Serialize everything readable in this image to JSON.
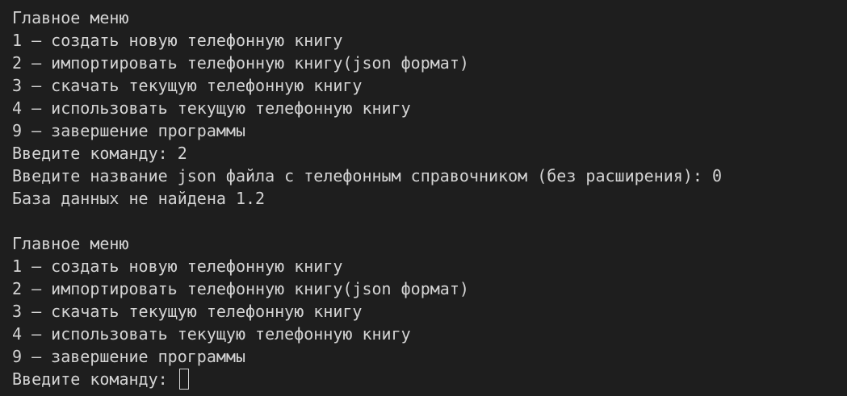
{
  "colors": {
    "background": "#1e1e1e",
    "text": "#d4d4d4",
    "cursor": "#d4d4d4"
  },
  "session_1": {
    "menu_title": "Главное меню",
    "items": [
      "1 – создать новую телефонную книгу",
      "2 – импортировать телефонную книгу(json формат)",
      "3 – скачать текущую телефонную книгу",
      "4 – использовать текущую телефонную книгу",
      "9 – завершение программы"
    ],
    "command_prompt": "Введите команду: 2",
    "filename_prompt": "Введите название json файла с телефонным справочником (без расширения): 0",
    "error_message": "База данных не найдена 1.2"
  },
  "session_2": {
    "menu_title": "Главное меню",
    "items": [
      "1 – создать новую телефонную книгу",
      "2 – импортировать телефонную книгу(json формат)",
      "3 – скачать текущую телефонную книгу",
      "4 – использовать текущую телефонную книгу",
      "9 – завершение программы"
    ],
    "command_prompt_label": "Введите команду: "
  }
}
